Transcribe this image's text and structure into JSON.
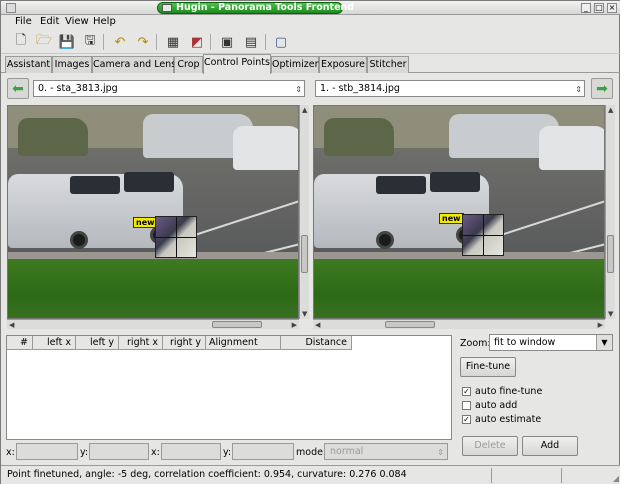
{
  "window": {
    "title": "Hugin - Panorama Tools Frontend",
    "controls": [
      "minimize-icon",
      "maximize-icon",
      "close-icon"
    ]
  },
  "menubar": {
    "items": [
      "File",
      "Edit",
      "View",
      "Help"
    ]
  },
  "toolbar": {
    "icons": [
      "new-project-icon",
      "open-folder-icon",
      "save-icon",
      "save-as-icon",
      "undo-icon",
      "redo-icon",
      "load-images-icon",
      "assistant-icon",
      "preview-icon",
      "fast-preview-icon",
      "stitch-icon"
    ]
  },
  "tabs": {
    "items": [
      "Assistant",
      "Images",
      "Camera and Lens",
      "Crop",
      "Control Points",
      "Optimizer",
      "Exposure",
      "Stitcher"
    ],
    "active": "Control Points"
  },
  "left_image": {
    "selector_value": "0. - sta_3813.jpg",
    "marker_label": "new"
  },
  "right_image": {
    "selector_value": "1. - stb_3814.jpg",
    "marker_label": "new"
  },
  "table": {
    "columns": [
      "#",
      "left x",
      "left y",
      "right x",
      "right y",
      "Alignment",
      "Distance"
    ],
    "rows": []
  },
  "editor": {
    "x1_label": "x:",
    "y1_label": "y:",
    "x2_label": "x:",
    "y2_label": "y:",
    "mode_label": "mode:",
    "mode_value": "normal"
  },
  "side": {
    "zoom_label": "Zoom:",
    "zoom_value": "fit to window",
    "finetune_label": "Fine-tune",
    "checks": [
      {
        "label": "auto fine-tune",
        "checked": true
      },
      {
        "label": "auto add",
        "checked": false
      },
      {
        "label": "auto estimate",
        "checked": true
      }
    ],
    "delete_label": "Delete",
    "add_label": "Add"
  },
  "status": {
    "text": "Point finetuned, angle: -5 deg, correlation coefficient: 0.954, curvature: 0.276 0.084"
  },
  "colors": {
    "title_green": "#2a9a2a",
    "marker_yellow": "#f2e800",
    "nav_arrow_green": "#3fa13f"
  }
}
